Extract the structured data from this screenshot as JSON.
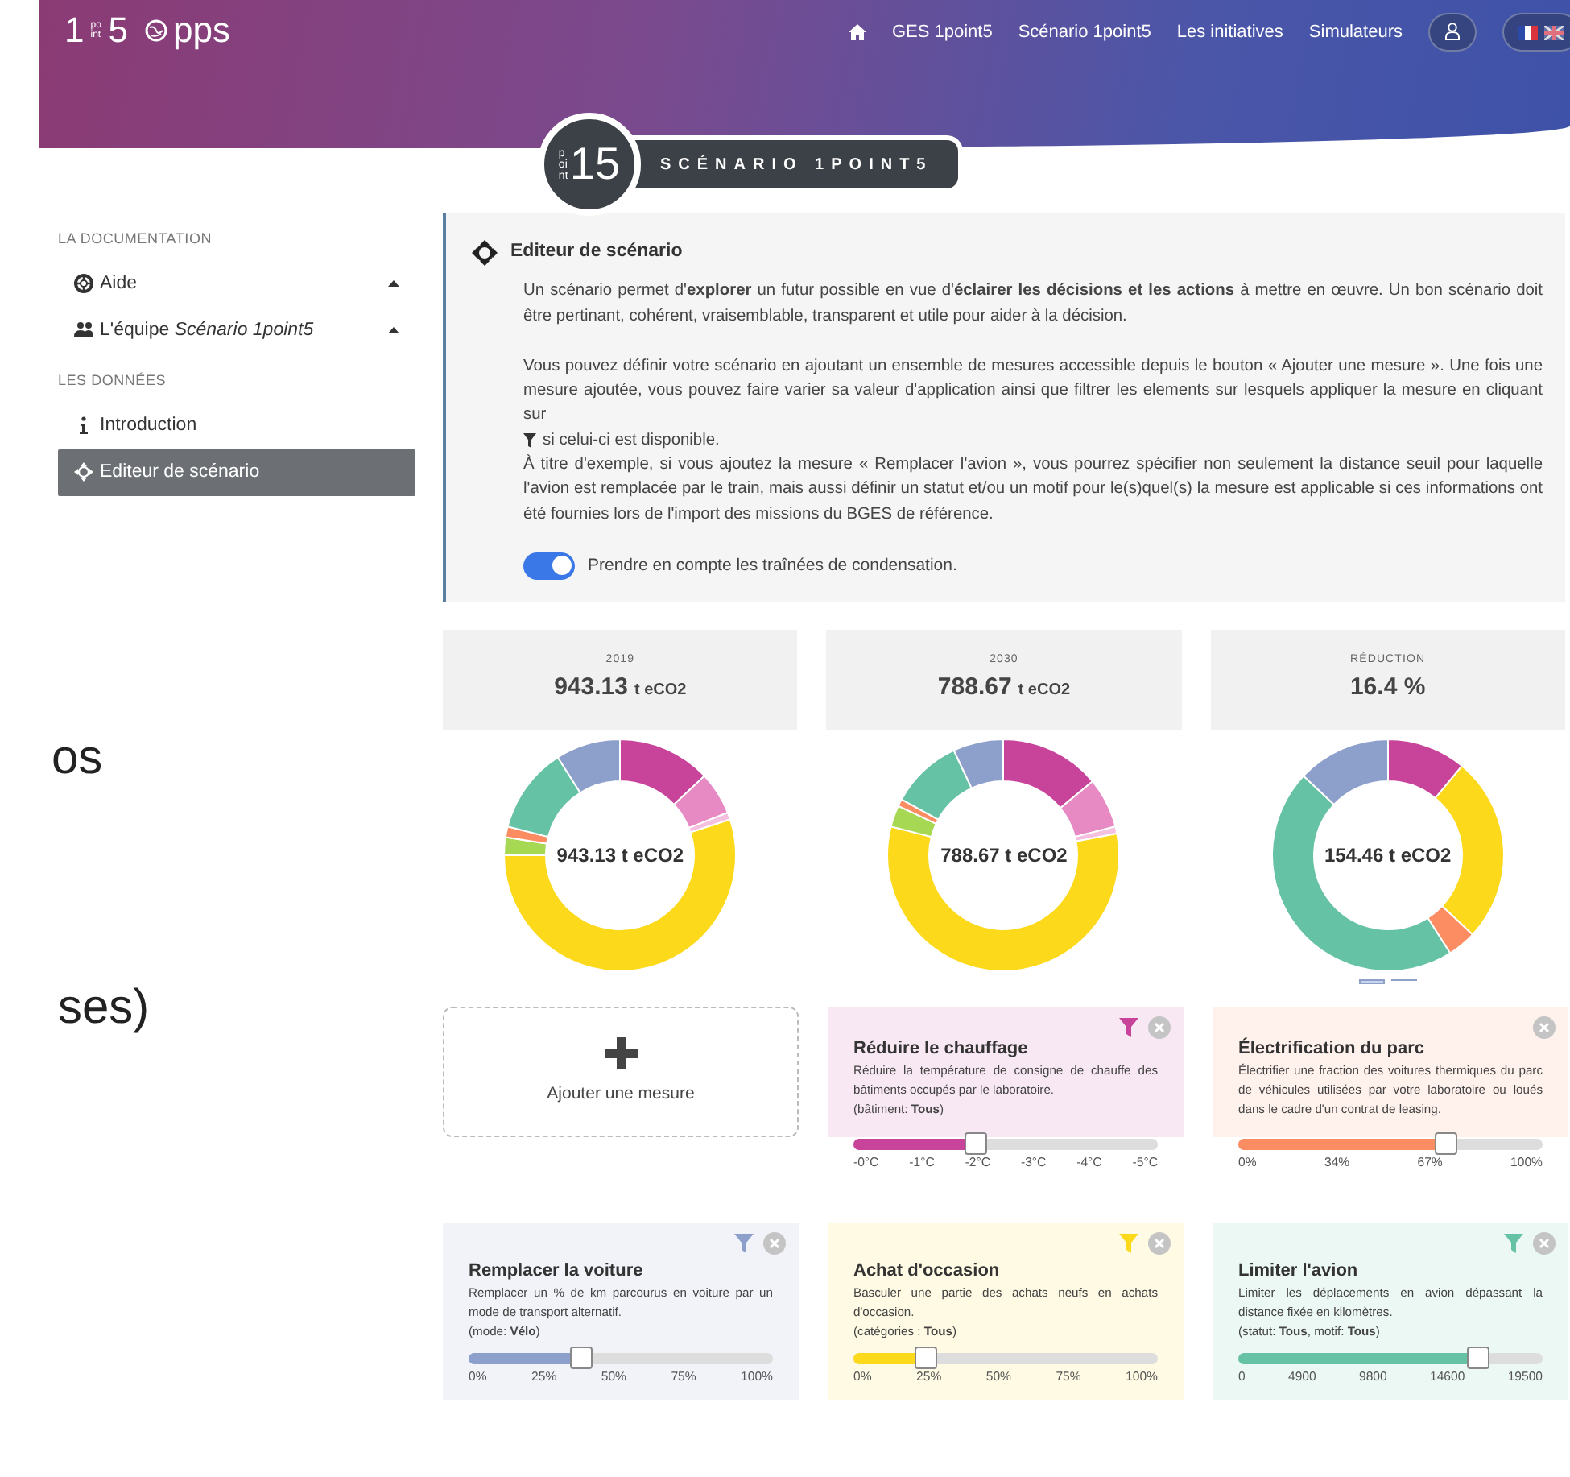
{
  "header": {
    "logo": {
      "number": "1",
      "small": "point",
      "number2": "5",
      "suffix": "pps"
    },
    "nav": [
      "GES 1point5",
      "Scénario 1point5",
      "Les initiatives",
      "Simulateurs"
    ],
    "badge": {
      "small": "point",
      "number": "15",
      "title": "SCÉNARIO 1POINT5"
    }
  },
  "sidebar": {
    "sections": [
      {
        "heading": "LA DOCUMENTATION",
        "items": [
          {
            "kind": "lifebuoy",
            "label": "Aide",
            "selected": false,
            "expandable": true
          },
          {
            "kind": "team",
            "label": "L'équipe *Scénario 1point5*",
            "selected": false,
            "expandable": true
          }
        ]
      },
      {
        "heading": "LES DONNÉES",
        "items": [
          {
            "kind": "info",
            "label": "Introduction",
            "selected": false,
            "expandable": false
          },
          {
            "kind": "move",
            "label": "Editeur de scénario",
            "selected": true,
            "expandable": false
          }
        ]
      }
    ]
  },
  "fragments": [
    "os",
    "ses)"
  ],
  "intro": {
    "title": "Editeur de scénario",
    "p1": "Un scénario permet d'**explorer** un futur possible en vue d'**éclairer les décisions et les actions** à mettre en œuvre. Un bon scénario doit être pertinant, cohérent, vraisemblable, transparent et utile pour aider à la décision.",
    "p2_before": "Vous pouvez définir votre scénario en ajoutant un ensemble de mesures accessible depuis le bouton « Ajouter une mesure ». Une fois une mesure ajoutée, vous pouvez faire varier sa valeur d'application ainsi que filtrer les elements sur lesquels appliquer la mesure en cliquant sur",
    "p2_after": "si celui-ci est disponible.",
    "p3": "À titre d'exemple, si vous ajoutez la mesure « Remplacer l'avion », vous pourrez spécifier non seulement la distance seuil pour laquelle l'avion est remplacée par le train, mais aussi définir un statut et/ou un motif pour le(s)quel(s) la mesure est applicable si ces informations ont été fournies lors de l'import des missions du BGES de référence.",
    "toggle": {
      "label": "Prendre en compte les traînées de condensation.",
      "on": true
    }
  },
  "stats": [
    {
      "label": "2019",
      "value": "943.13",
      "unit": "t eCO2"
    },
    {
      "label": "2030",
      "value": "788.67",
      "unit": "t eCO2"
    },
    {
      "label": "RÉDUCTION",
      "value": "16.4 %"
    }
  ],
  "donuts": [
    {
      "center": "943.13 t eCO2"
    },
    {
      "center": "788.67 t eCO2"
    },
    {
      "center": "154.46 t eCO2"
    }
  ],
  "pager": [
    {
      "selected": true
    },
    {
      "selected": false
    }
  ],
  "add_measure": {
    "label": "Ajouter une mesure"
  },
  "measures": [
    {
      "title": "Réduire le chauffage",
      "desc": "Réduire la température de consigne de chauffe des bâtiments occupés par le laboratoire.",
      "filter": "(bâtiment: **Tous**)",
      "has_filter": true,
      "color": "#c8449a",
      "level": 0.4,
      "ticks": [
        "-0°C",
        "-1°C",
        "-2°C",
        "-3°C",
        "-4°C",
        "-5°C"
      ]
    },
    {
      "title": "Électrification du parc",
      "desc": "Électrifier une fraction des voitures thermiques du parc de véhicules utilisées par votre laboratoire ou loués dans le cadre d'un contrat de leasing.",
      "has_filter": false,
      "color": "#fc8d62",
      "level": 0.68,
      "ticks": [
        "0%",
        "34%",
        "67%",
        "100%"
      ]
    },
    {
      "title": "Remplacer la voiture",
      "desc": "Remplacer un % de km parcourus en voiture par un mode de transport alternatif.",
      "filter": "(mode: **Vélo**)",
      "has_filter": true,
      "color": "#8da0cb",
      "level": 0.37,
      "ticks": [
        "0%",
        "25%",
        "50%",
        "75%",
        "100%"
      ]
    },
    {
      "title": "Achat d'occasion",
      "desc": "Basculer une partie des achats neufs en achats d'occasion.",
      "filter": "(catégories : **Tous**)",
      "has_filter": true,
      "color": "#fcd91b",
      "level": 0.24,
      "ticks": [
        "0%",
        "25%",
        "50%",
        "75%",
        "100%"
      ]
    },
    {
      "title": "Limiter l'avion",
      "desc": "Limiter les déplacements en avion dépassant la distance fixée en kilomètres.",
      "filter": "(statut: **Tous**, motif: **Tous**)",
      "has_filter": true,
      "color": "#66c2a5",
      "level": 0.79,
      "ticks": [
        "0",
        "4900",
        "9800",
        "14600",
        "19500"
      ]
    }
  ]
}
